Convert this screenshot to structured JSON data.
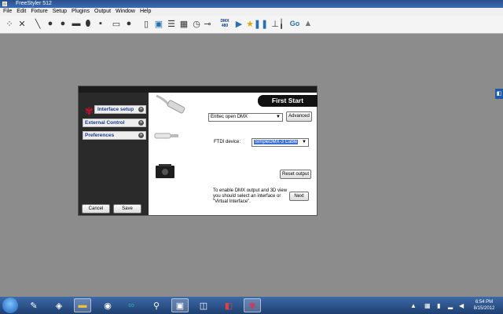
{
  "window": {
    "title": "FreeStyler 512"
  },
  "menu": [
    "File",
    "Edit",
    "Fixture",
    "Setup",
    "Plugins",
    "Output",
    "Window",
    "Help"
  ],
  "toolbar": {
    "icons": [
      "grid-dots-icon",
      "cross-icon",
      "pen-icon",
      "circle-icon",
      "circle-icon",
      "lamp-icon",
      "scanner-icon",
      "light-icon",
      "square-icon",
      "palette-icon",
      "document-icon",
      "monitor-icon",
      "list-icon",
      "grid-icon",
      "clock-icon",
      "power-icon",
      "dmx-icon",
      "play-icon",
      "star-icon",
      "pause-icon",
      "pin-icon",
      "fader-icon",
      "go-icon",
      "triangle-icon"
    ],
    "dmx_label": "DMX\n480",
    "go_label": "Go"
  },
  "dialog": {
    "banner": "First Start",
    "nav": [
      {
        "label": "Interface setup",
        "active": true
      },
      {
        "label": "External Control",
        "active": false
      },
      {
        "label": "Preferences",
        "active": false
      }
    ],
    "interface_select": "Enttec open DMX",
    "advanced_label": "Advanced",
    "ftdi_label": "FTDI device:",
    "ftdi_select": "SimpleDMX-3 Cable",
    "reset_label": "Reset output",
    "info_text": "To enable DMX output and 3D view you should select an interface or \"Virtual Interface\".",
    "next_label": "Next",
    "cancel_label": "Cancel",
    "save_label": "Save"
  },
  "taskbar": {
    "time": "6:54 PM",
    "date": "8/15/2012"
  },
  "colors": {
    "accent": "#c8102e",
    "nav_text": "#1a3b86",
    "selection": "#3b70d6"
  }
}
